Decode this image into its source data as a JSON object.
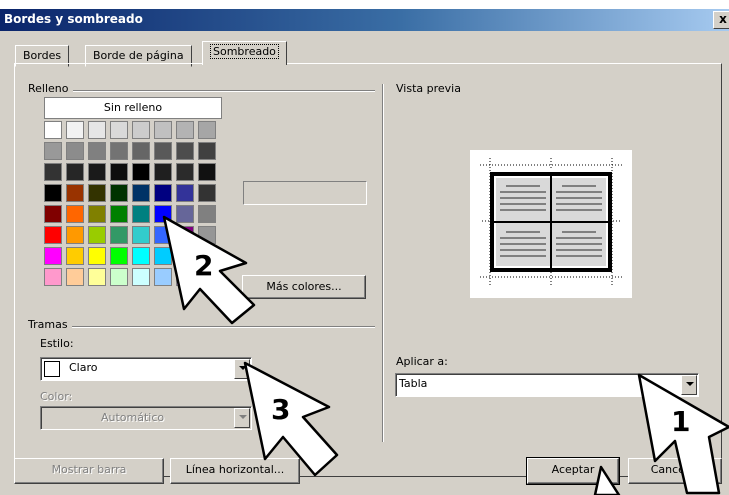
{
  "window": {
    "title": "Bordes y sombreado",
    "close": "x"
  },
  "tabs": [
    {
      "label": "Bordes"
    },
    {
      "label": "Borde de página"
    },
    {
      "label": "Sombreado"
    }
  ],
  "relleno": {
    "label": "Relleno",
    "no_fill": "Sin relleno",
    "more_colors": "Más colores...",
    "palette": [
      [
        "#ffffff",
        "#f2f2f2",
        "#e6e6e6",
        "#d9d9d9",
        "#cccccc",
        "#c0c0c0",
        "#b3b3b3",
        "#a6a6a6"
      ],
      [
        "#999999",
        "#8c8c8c",
        "#808080",
        "#737373",
        "#666666",
        "#595959",
        "#4d4d4d",
        "#404040"
      ],
      [
        "#333333",
        "#262626",
        "#1a1a1a",
        "#0d0d0d",
        "#000000",
        "#1f1f1f",
        "#2b2b2b",
        "#111111"
      ],
      [
        "#000000",
        "#993300",
        "#333300",
        "#003300",
        "#003366",
        "#000080",
        "#333399",
        "#333333"
      ],
      [
        "#800000",
        "#ff6600",
        "#808000",
        "#008000",
        "#008080",
        "#0000ff",
        "#666699",
        "#808080"
      ],
      [
        "#ff0000",
        "#ff9900",
        "#99cc00",
        "#339966",
        "#33cccc",
        "#3366ff",
        "#800080",
        "#969696"
      ],
      [
        "#ff00ff",
        "#ffcc00",
        "#ffff00",
        "#00ff00",
        "#00ffff",
        "#00ccff",
        "#993366",
        "#c0c0c0"
      ],
      [
        "#ff99cc",
        "#ffcc99",
        "#ffff99",
        "#ccffcc",
        "#ccffff",
        "#99ccff",
        "#cc99ff",
        "#ffffff"
      ]
    ]
  },
  "tramas": {
    "label": "Tramas",
    "style_label": "Estilo:",
    "style_value": "Claro",
    "color_label": "Color:",
    "color_value": "Automático"
  },
  "vista_previa": {
    "label": "Vista previa"
  },
  "aplicar": {
    "label": "Aplicar a:",
    "value": "Tabla"
  },
  "buttons": {
    "mostrar_barra": "Mostrar barra",
    "linea_horizontal": "Línea horizontal...",
    "aceptar": "Aceptar",
    "cancelar": "Cancelar"
  },
  "arrows": [
    "1",
    "2",
    "3"
  ]
}
